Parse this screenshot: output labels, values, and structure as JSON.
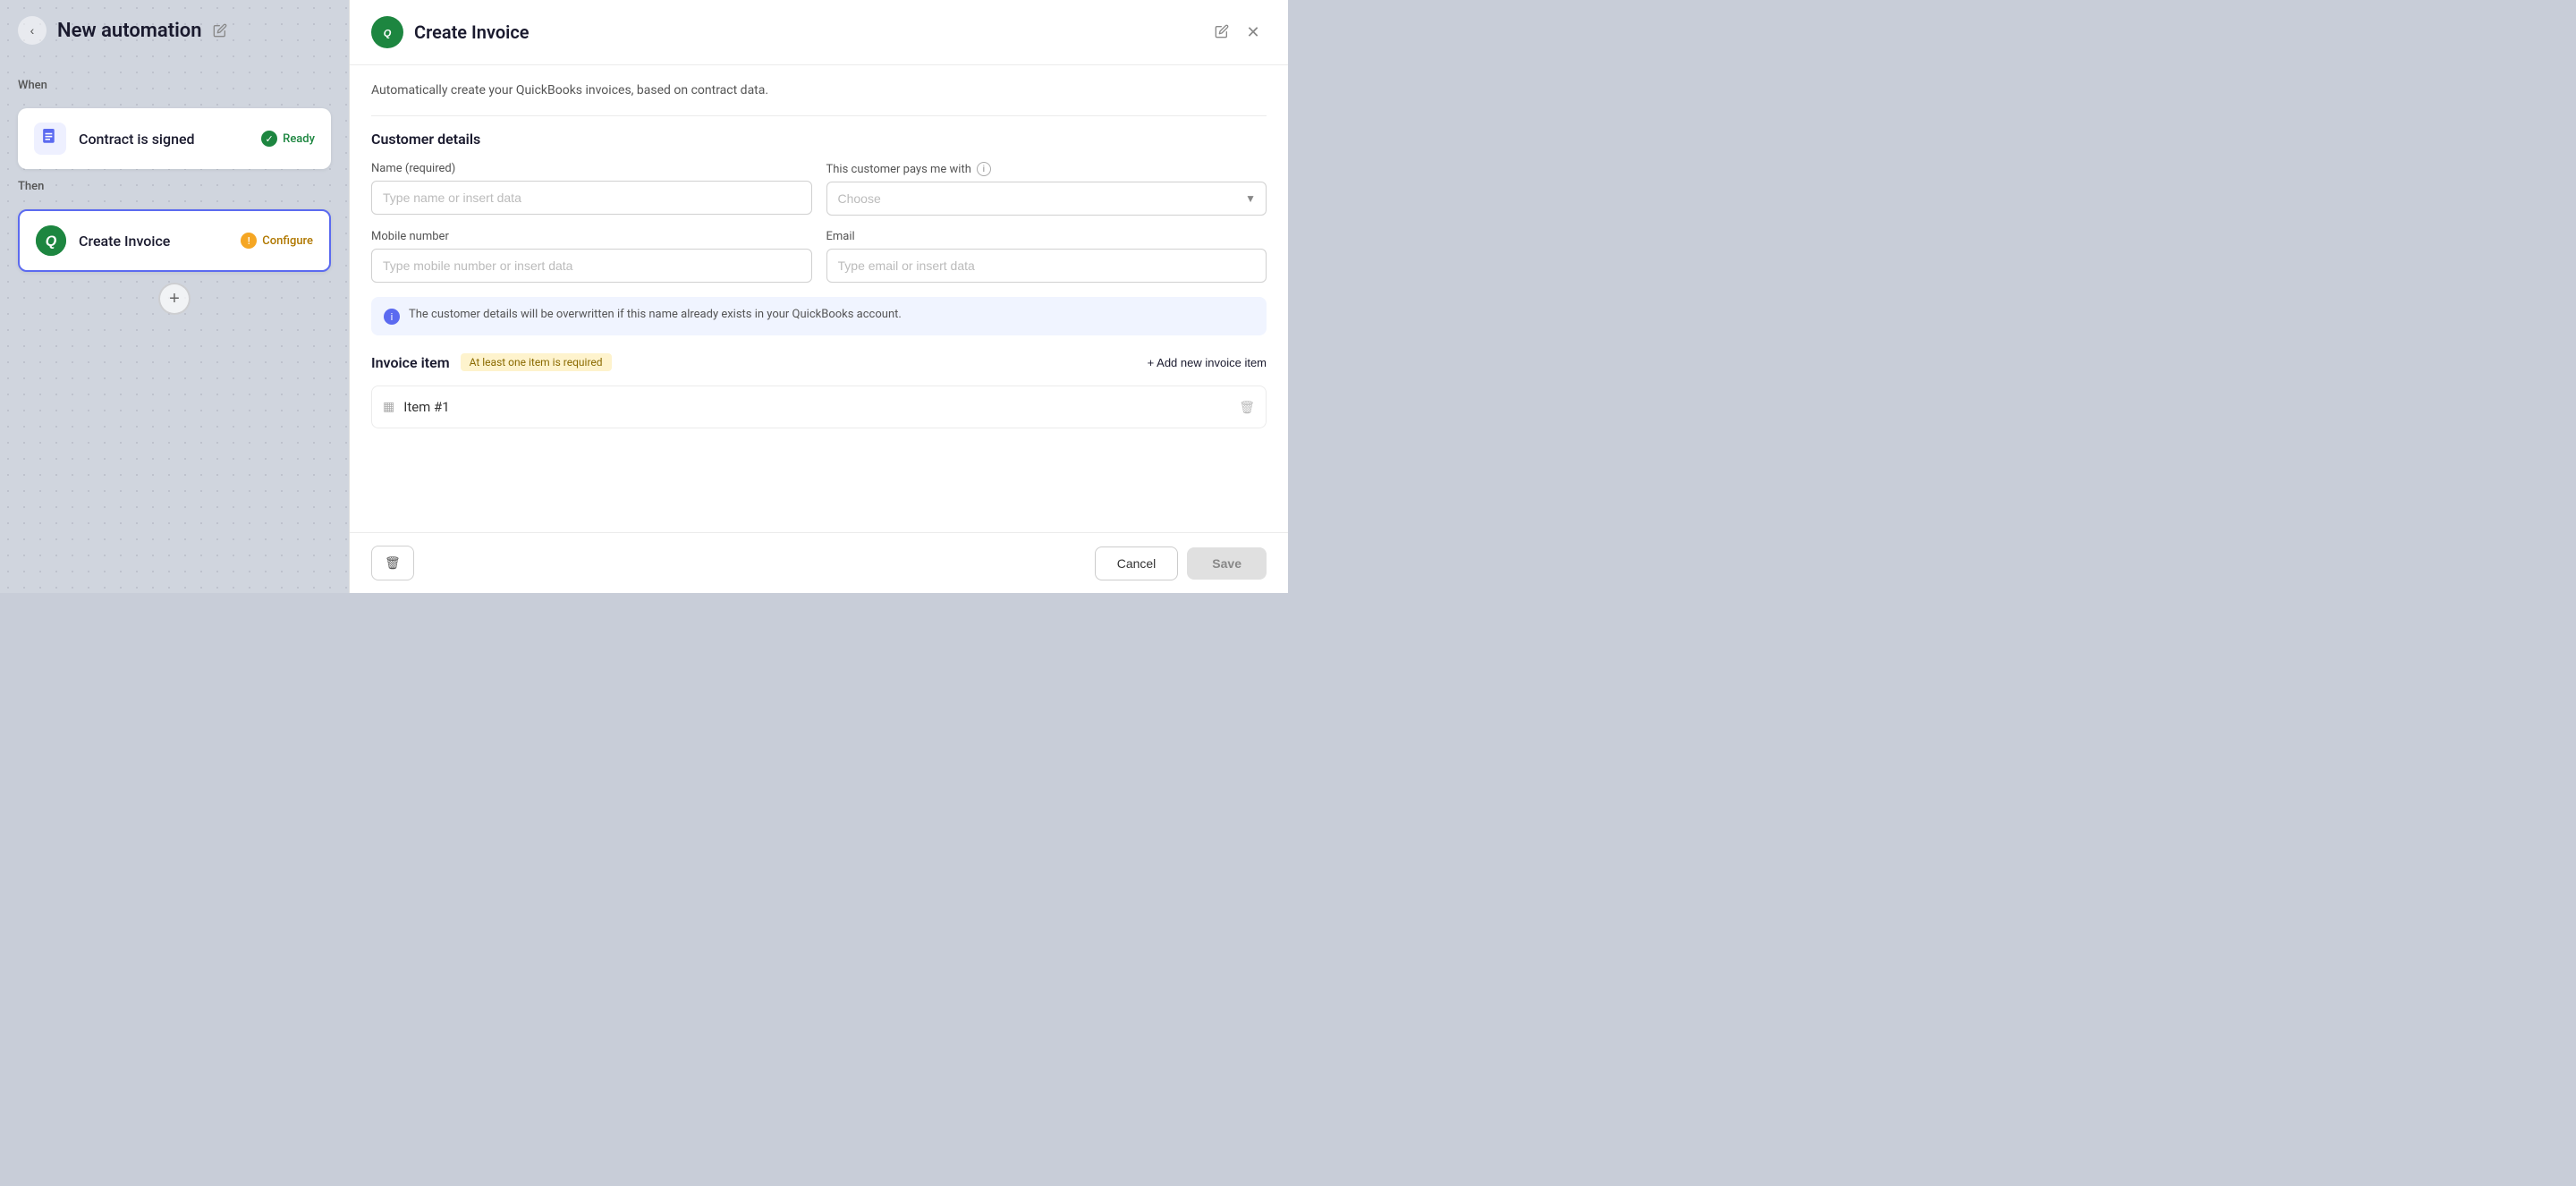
{
  "header": {
    "back_label": "‹",
    "title": "New automation",
    "edit_icon": "✏️"
  },
  "left": {
    "when_label": "When",
    "then_label": "Then",
    "trigger_card": {
      "icon": "📄",
      "title": "Contract is signed",
      "status": "Ready",
      "status_type": "ready"
    },
    "action_card": {
      "title": "Create Invoice",
      "status": "Configure",
      "status_type": "configure"
    },
    "add_button": "+"
  },
  "right": {
    "title": "Create Invoice",
    "description": "Automatically create your QuickBooks invoices, based on contract data.",
    "close_icon": "✕",
    "edit_icon": "✏️",
    "customer_section_title": "Customer details",
    "name_label": "Name (required)",
    "name_placeholder": "Type name or insert data",
    "pays_with_label": "This customer pays me with",
    "pays_with_placeholder": "Choose",
    "mobile_label": "Mobile number",
    "mobile_placeholder": "Type mobile number or insert data",
    "email_label": "Email",
    "email_placeholder": "Type email or insert data",
    "info_text": "The customer details will be overwritten if this name already exists in your QuickBooks account.",
    "invoice_section_title": "Invoice item",
    "required_badge": "At least one item is required",
    "add_item_btn": "+ Add new invoice item",
    "items": [
      {
        "label": "Item #1"
      }
    ],
    "footer": {
      "cancel_label": "Cancel",
      "save_label": "Save"
    }
  }
}
